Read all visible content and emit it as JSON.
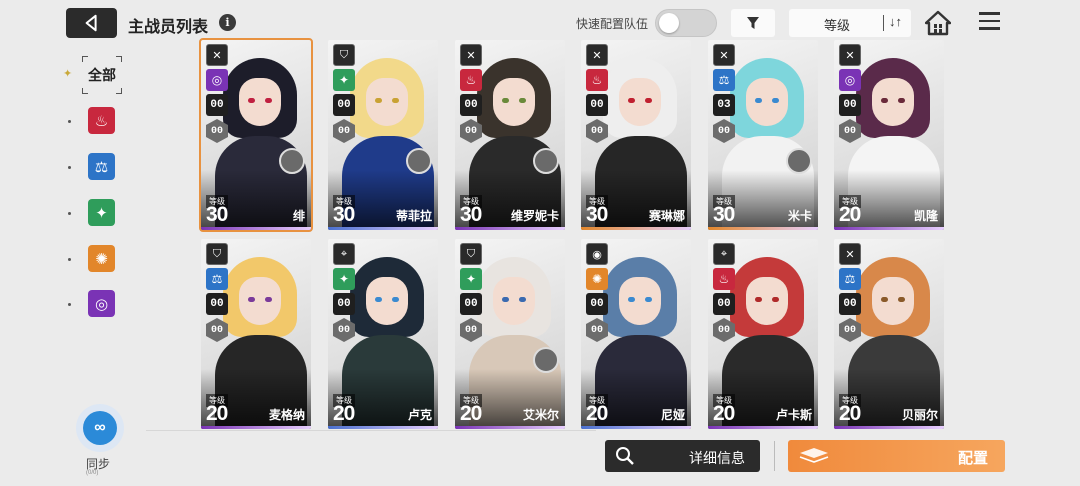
{
  "header": {
    "title": "主战员列表",
    "info_icon": "i",
    "quick_config_label": "快速配置队伍",
    "quick_config_enabled": false,
    "sort_label": "等级",
    "sort_icon": "↓↑"
  },
  "filters": {
    "all_label": "全部",
    "elements": [
      {
        "name": "fire",
        "color": "#c8283e"
      },
      {
        "name": "balance",
        "color": "#2d74c7"
      },
      {
        "name": "star",
        "color": "#2f9d5b"
      },
      {
        "name": "sun",
        "color": "#e2862a"
      },
      {
        "name": "swirl",
        "color": "#7a33b5"
      }
    ]
  },
  "sync": {
    "label": "同步",
    "sub_label": "(0/0)"
  },
  "level_tag": "等级",
  "cards": [
    {
      "name": "绯",
      "level": "30",
      "class_icon": "cross-swords",
      "element": "swirl",
      "element_color": "#7a33b5",
      "stat_a": "00",
      "stat_b": "00",
      "hair": "#1d1d2a",
      "outfit": "#2a2a3a",
      "eye": "#c02040",
      "strip": "#7a33b5",
      "selected": true,
      "avatar": true
    },
    {
      "name": "蒂菲拉",
      "level": "30",
      "class_icon": "shield",
      "element": "star",
      "element_color": "#2f9d5b",
      "stat_a": "00",
      "stat_b": "00",
      "hair": "#f2d98a",
      "outfit": "#1f3b8a",
      "eye": "#c9a233",
      "strip": "#4a70d0",
      "selected": false,
      "avatar": true
    },
    {
      "name": "维罗妮卡",
      "level": "30",
      "class_icon": "cross-swords",
      "element": "fire",
      "element_color": "#c8283e",
      "stat_a": "00",
      "stat_b": "00",
      "hair": "#3a332c",
      "outfit": "#2a2a2a",
      "eye": "#6a8a3a",
      "strip": "#7a33b5",
      "selected": false,
      "avatar": true
    },
    {
      "name": "赛琳娜",
      "level": "30",
      "class_icon": "cross-swords",
      "element": "fire",
      "element_color": "#c8283e",
      "stat_a": "00",
      "stat_b": "00",
      "hair": "#eeeeee",
      "outfit": "#262626",
      "eye": "#c02030",
      "strip": "#e2862a",
      "selected": false,
      "avatar": false
    },
    {
      "name": "米卡",
      "level": "30",
      "class_icon": "cross-swords",
      "element": "balance",
      "element_color": "#2d74c7",
      "stat_a": "03",
      "stat_b": "00",
      "hair": "#7ed6dc",
      "outfit": "#f2f2f2",
      "eye": "#3a8ad0",
      "strip": "#e2862a",
      "selected": false,
      "avatar": true
    },
    {
      "name": "凯隆",
      "level": "20",
      "class_icon": "cross-swords",
      "element": "swirl",
      "element_color": "#7a33b5",
      "stat_a": "00",
      "stat_b": "00",
      "hair": "#5a2a4a",
      "outfit": "#f4f4f4",
      "eye": "#6a2a3a",
      "strip": "#7a33b5",
      "selected": false,
      "avatar": false
    },
    {
      "name": "麦格纳",
      "level": "20",
      "class_icon": "shield",
      "element": "balance",
      "element_color": "#2d74c7",
      "stat_a": "00",
      "stat_b": "00",
      "hair": "#f2c86a",
      "outfit": "#262626",
      "eye": "#7a3a9a",
      "strip": "#7a33b5",
      "selected": false,
      "avatar": false
    },
    {
      "name": "卢克",
      "level": "20",
      "class_icon": "crosshair",
      "element": "star",
      "element_color": "#2f9d5b",
      "stat_a": "00",
      "stat_b": "00",
      "hair": "#1e2a38",
      "outfit": "#2a3a3a",
      "eye": "#3a8ad0",
      "strip": "#4a70d0",
      "selected": false,
      "avatar": false
    },
    {
      "name": "艾米尔",
      "level": "20",
      "class_icon": "shield",
      "element": "star",
      "element_color": "#2f9d5b",
      "stat_a": "00",
      "stat_b": "00",
      "hair": "#e8e4e0",
      "outfit": "#d8c8b8",
      "eye": "#3a6ab0",
      "strip": "#7a33b5",
      "selected": false,
      "avatar": true
    },
    {
      "name": "尼娅",
      "level": "20",
      "class_icon": "target",
      "element": "sun",
      "element_color": "#e2862a",
      "stat_a": "00",
      "stat_b": "00",
      "hair": "#5a7ea8",
      "outfit": "#2a2a3a",
      "eye": "#3a8ad0",
      "strip": "#4a70d0",
      "selected": false,
      "avatar": false
    },
    {
      "name": "卢卡斯",
      "level": "20",
      "class_icon": "crosshair",
      "element": "fire",
      "element_color": "#c8283e",
      "stat_a": "00",
      "stat_b": "00",
      "hair": "#c43a3a",
      "outfit": "#2a2a2a",
      "eye": "#b02a2a",
      "strip": "#7a33b5",
      "selected": false,
      "avatar": false
    },
    {
      "name": "贝丽尔",
      "level": "20",
      "class_icon": "cross-swords",
      "element": "balance",
      "element_color": "#2d74c7",
      "stat_a": "00",
      "stat_b": "00",
      "hair": "#d8884a",
      "outfit": "#3a3a3a",
      "eye": "#8a5a2a",
      "strip": "#7a33b5",
      "selected": false,
      "avatar": false
    }
  ],
  "actions": {
    "detail_label": "详细信息",
    "config_label": "配置"
  }
}
